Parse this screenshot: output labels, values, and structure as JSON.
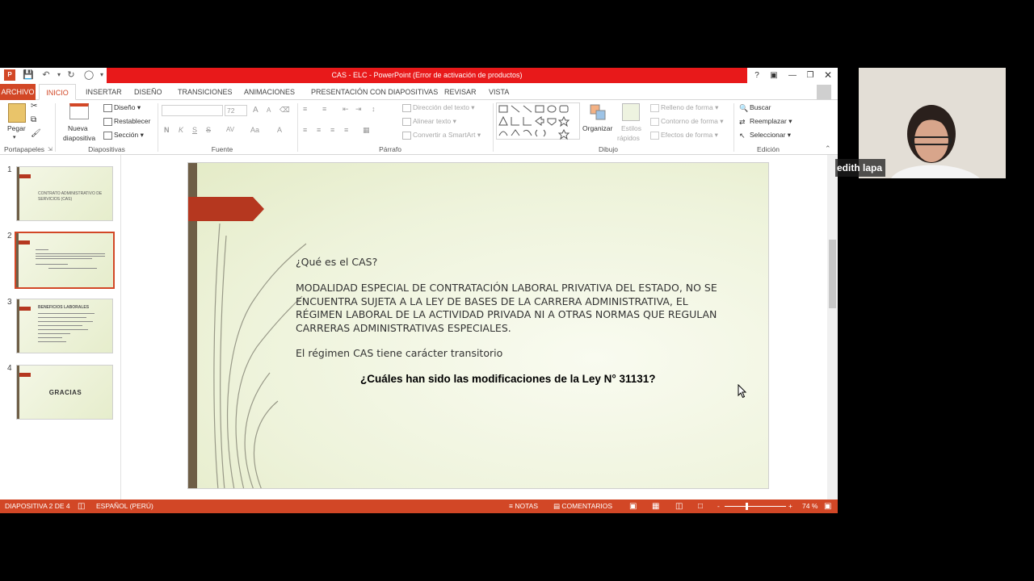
{
  "window": {
    "title": "CAS - ELC -  PowerPoint (Error de activación de productos)",
    "help": "?"
  },
  "tabs": [
    {
      "label": "ARCHIVO"
    },
    {
      "label": "INICIO"
    },
    {
      "label": "INSERTAR"
    },
    {
      "label": "DISEÑO"
    },
    {
      "label": "TRANSICIONES"
    },
    {
      "label": "ANIMACIONES"
    },
    {
      "label": "PRESENTACIÓN CON DIAPOSITIVAS"
    },
    {
      "label": "REVISAR"
    },
    {
      "label": "VISTA"
    }
  ],
  "ribbon": {
    "portapapeles": {
      "label": "Portapapeles",
      "pegar": "Pegar"
    },
    "diapositivas": {
      "label": "Diapositivas",
      "nueva1": "Nueva",
      "nueva2": "diapositiva",
      "diseno": "Diseño",
      "restablecer": "Restablecer",
      "seccion": "Sección"
    },
    "fuente": {
      "label": "Fuente",
      "size": "72",
      "bold": "N",
      "italic": "K",
      "underline": "S",
      "strike": "S",
      "spacing": "AV",
      "case": "Aa",
      "color": "A",
      "grow": "A",
      "shrink": "A"
    },
    "parrafo": {
      "label": "Párrafo",
      "direccion": "Dirección del texto",
      "alinear": "Alinear texto",
      "smartart": "Convertir a SmartArt"
    },
    "dibujo": {
      "label": "Dibujo",
      "organizar": "Organizar",
      "estilos1": "Estilos",
      "estilos2": "rápidos",
      "relleno": "Relleno de forma",
      "contorno": "Contorno de forma",
      "efectos": "Efectos de forma"
    },
    "edicion": {
      "label": "Edición",
      "buscar": "Buscar",
      "reemplazar": "Reemplazar",
      "seleccionar": "Seleccionar"
    }
  },
  "thumbnails": [
    {
      "num": "1",
      "title": "CONTRATO ADMINISTRATIVO DE SERVICIOS (CAS)"
    },
    {
      "num": "2"
    },
    {
      "num": "3",
      "title": "BENEFICIOS LABORALES"
    },
    {
      "num": "4",
      "title": "GRACIAS"
    }
  ],
  "slide": {
    "q1": "¿Qué es el CAS?",
    "para": "MODALIDAD ESPECIAL DE CONTRATACIÓN LABORAL PRIVATIVA DEL ESTADO, NO SE ENCUENTRA SUJETA A LA LEY DE BASES DE LA CARRERA ADMINISTRATIVA, EL RÉGIMEN LABORAL DE LA ACTIVIDAD PRIVADA NI A OTRAS NORMAS QUE REGULAN CARRERAS ADMINISTRATIVAS ESPECIALES.",
    "regimen": "El régimen CAS tiene carácter transitorio",
    "question": "¿Cuáles han sido las modificaciones de la Ley N° 31131?"
  },
  "statusbar": {
    "slide": "DIAPOSITIVA 2 DE 4",
    "language": "ESPAÑOL (PERÚ)",
    "notas": "NOTAS",
    "comentarios": "COMENTARIOS",
    "zoom": "74 %"
  },
  "webcam": {
    "name": "edith lapa"
  },
  "colors": {
    "accent": "#d24726",
    "titleband": "#e8191a",
    "slidebar": "#6e5e46",
    "arrow": "#b5371f"
  }
}
